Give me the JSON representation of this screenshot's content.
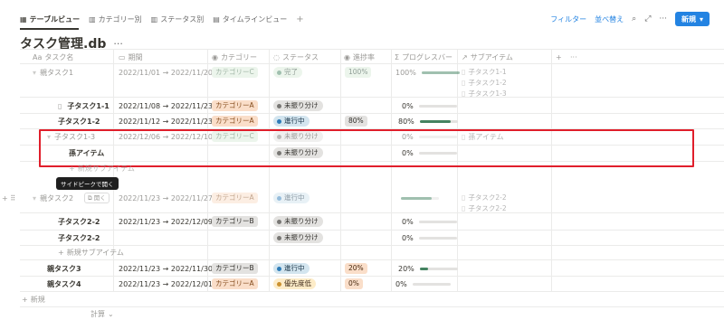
{
  "tabs": [
    {
      "label": "テーブルビュー",
      "icon": "table-icon",
      "active": true
    },
    {
      "label": "カテゴリー別",
      "icon": "board-icon"
    },
    {
      "label": "ステータス別",
      "icon": "board-icon"
    },
    {
      "label": "タイムラインビュー",
      "icon": "timeline-icon"
    }
  ],
  "toolbar": {
    "filter": "フィルター",
    "sort": "並べ替え",
    "new": "新規"
  },
  "db": {
    "title": "タスク管理.db"
  },
  "columns": [
    "タスク名",
    "期間",
    "カテゴリー",
    "ステータス",
    "進捗率",
    "プログレスバー",
    "サブアイテム"
  ],
  "rows": [
    {
      "name": "親タスク1",
      "period": "2022/11/01 → 2022/11/20",
      "category": "カテゴリーC",
      "status": "完了",
      "progress": "100%",
      "bar": "100%",
      "subs": [
        "子タスク1-1",
        "子タスク1-2",
        "子タスク1-3"
      ]
    },
    {
      "name": "子タスク1-1",
      "period": "2022/11/08 → 2022/11/23",
      "category": "カテゴリーA",
      "status": "未振り分け",
      "progress": "",
      "bar": "0%",
      "subs": []
    },
    {
      "name": "子タスク1-2",
      "period": "2022/11/12 → 2022/11/23",
      "category": "カテゴリーA",
      "status": "進行中",
      "progress": "80%",
      "bar": "80%",
      "subs": []
    },
    {
      "name": "子タスク1-3",
      "period": "2022/12/06 → 2022/12/10",
      "category": "カテゴリーC",
      "status": "未振り分け",
      "progress": "",
      "bar": "0%",
      "subs": [
        "孫アイテム"
      ]
    },
    {
      "name": "孫アイテム",
      "period": "",
      "category": "",
      "status": "未振り分け",
      "progress": "",
      "bar": "0%",
      "subs": []
    },
    {
      "name": "親タスク2",
      "period": "2022/11/23 → 2022/11/27",
      "category": "カテゴリーA",
      "status": "進行中",
      "progress": "",
      "bar": "",
      "subs": [
        "子タスク2-2",
        "子タスク2-2"
      ]
    },
    {
      "name": "子タスク2-2",
      "period": "2022/11/23 → 2022/12/09",
      "category": "カテゴリーB",
      "status": "未振り分け",
      "progress": "",
      "bar": "0%",
      "subs": []
    },
    {
      "name": "子タスク2-2",
      "period": "2022/11/23 → 2022/12/09",
      "category": "カテゴリーB",
      "status": "未振り分け",
      "progress": "",
      "bar": "0%",
      "subs": []
    },
    {
      "name": "親タスク3",
      "period": "2022/11/23 → 2022/11/30",
      "category": "カテゴリーB",
      "status": "進行中",
      "progress": "20%",
      "bar": "20%",
      "subs": []
    },
    {
      "name": "親タスク4",
      "period": "2022/11/23 → 2022/12/01",
      "category": "カテゴリーA",
      "status": "優先度低",
      "progress": "0%",
      "bar": "0%",
      "subs": []
    }
  ],
  "misc": {
    "new_sub_item": "新規サブアイテム",
    "new_row": "新規",
    "calc": "計算",
    "tooltip": "サイドピークで開く",
    "open": "開く"
  }
}
